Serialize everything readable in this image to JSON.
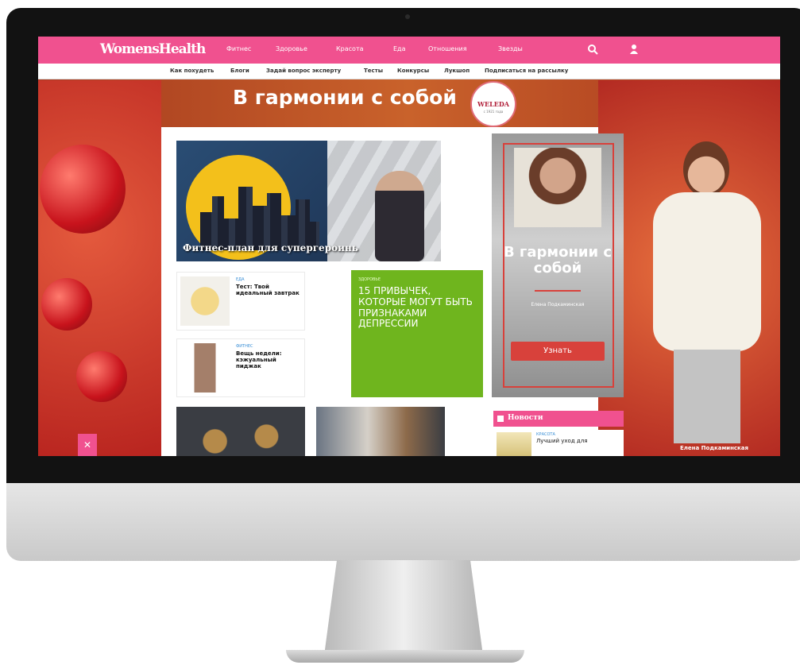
{
  "site": {
    "logo": "WomensHealth",
    "brand_color": "#f0518f"
  },
  "topnav": {
    "items": [
      "Фитнес",
      "Здоровье",
      "Красота",
      "Еда",
      "Отношения",
      "Звезды"
    ],
    "search_icon": "search-icon",
    "user_icon": "user-icon"
  },
  "subnav": {
    "items": [
      "Как похудеть",
      "Блоги",
      "Задай вопрос эксперту",
      "Тесты",
      "Конкурсы",
      "Лукшоп",
      "Подписаться на рассылку"
    ]
  },
  "banner": {
    "title": "В гармонии с собой",
    "brand": "WELEDA",
    "brand_since": "с 1921 года"
  },
  "hero": {
    "caption": "Фитнес-план для супергероинь"
  },
  "cards": [
    {
      "category": "ЕДА",
      "title": "Тест: Твой идеальный завтрак"
    },
    {
      "category": "ФИТНЕС",
      "title": "Вещь недели: кэжуальный пиджак"
    }
  ],
  "green_card": {
    "category": "ЗДОРОВЬЕ",
    "title": "15 ПРИВЫЧЕК, КОТОРЫЕ МОГУТ БЫТЬ ПРИЗНАКАМИ ДЕПРЕССИИ"
  },
  "ad": {
    "title": "В гармонии с собой",
    "name": "Елена Подкаминская",
    "button": "Узнать"
  },
  "news": {
    "header": "Новости",
    "item": {
      "category": "КРАСОТА",
      "title": "Лучший уход для"
    }
  },
  "right_panel": {
    "credit": "Елена Подкаминская"
  },
  "close_label": "✕"
}
